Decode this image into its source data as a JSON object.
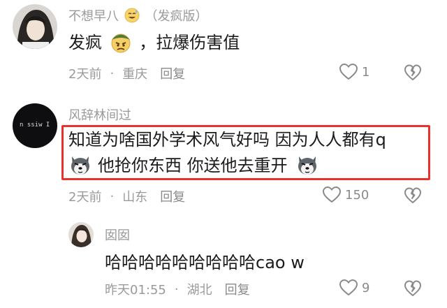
{
  "comments": [
    {
      "username": "不想早八",
      "username_suffix": "（发疯版）",
      "text_before": "发疯",
      "text_after": "，拉爆伤害值",
      "time": "2天前",
      "location": "重庆",
      "reply_label": "回复",
      "likes": "1"
    },
    {
      "username": "风辞林间过",
      "avatar_text": "n ssiw I",
      "line1": "知道为啥国外学术风气好吗 因为人人都有q",
      "line2": "他抢你东西 你送他去重开",
      "time": "2天前",
      "location": "山东",
      "reply_label": "回复",
      "likes": "150"
    },
    {
      "username": "囡囡",
      "text": "哈哈哈哈哈哈哈哈哈cao w",
      "time": "昨天01:55",
      "location": "湖北",
      "reply_label": "回复",
      "likes": "9"
    }
  ],
  "icons": {
    "like": "heart-outline-icon",
    "dislike": "broken-heart-icon"
  },
  "colors": {
    "highlight": "#e8322f",
    "meta_text": "#9a9a9a"
  }
}
